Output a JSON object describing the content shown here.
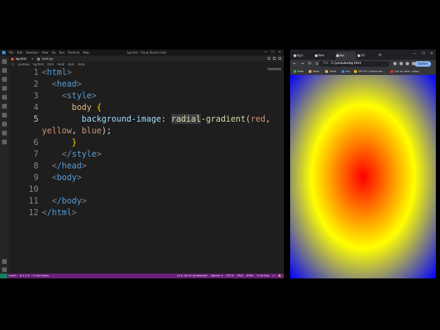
{
  "vscode": {
    "menu": [
      "File",
      "Edit",
      "Selection",
      "View",
      "Go",
      "Run",
      "Terminal",
      "Help"
    ],
    "window_title": "bg.html - Visual Studio Code",
    "window_controls": [
      "—",
      "☐",
      "✕"
    ],
    "tabs": [
      {
        "label": "bg.html",
        "active": true
      },
      {
        "label": "Settings",
        "active": false
      }
    ],
    "breadcrumb": [
      "C:",
      "youtube",
      "bg.html",
      "html",
      "head",
      "style",
      "body"
    ],
    "code_lines": [
      {
        "num": "1"
      },
      {
        "num": "2"
      },
      {
        "num": "3"
      },
      {
        "num": "4"
      },
      {
        "num": "5"
      },
      {
        "num": "6"
      },
      {
        "num": "7"
      },
      {
        "num": "8"
      },
      {
        "num": "9"
      },
      {
        "num": "10"
      },
      {
        "num": "11"
      },
      {
        "num": "12"
      }
    ],
    "code": {
      "html_tag": "html",
      "head_tag": "head",
      "style_tag": "style",
      "selector": "body",
      "open_brace": "{",
      "property": "background-image",
      "colon": ":",
      "fn_highlight": "radial",
      "fn_rest": "-gradient",
      "open_paren": "(",
      "val_red": "red",
      "comma1": ",",
      "val_yellow": "yellow",
      "comma2": ",",
      "val_blue": "blue",
      "close_paren_semicolon": ");",
      "close_brace": "}",
      "close_style": "/style",
      "close_head": "/head",
      "body_tag": "body",
      "close_body": "/body",
      "close_html": "/html"
    },
    "status_left": [
      "main*",
      "⊗ 0 ⚠ 0",
      "⊙ Live Share"
    ],
    "status_right": [
      "Ln 5, Col 31 (6 selected)",
      "Spaces: 4",
      "UTF-8",
      "CRLF",
      "HTML",
      "⊙ Go Live",
      "⚇",
      "🔔"
    ],
    "colors": {
      "status_bar": "#68217a",
      "editor_bg": "#1e1e1e"
    }
  },
  "chrome": {
    "tabs": [
      {
        "label": "bg.h",
        "active": false
      },
      {
        "label": "New",
        "active": false
      },
      {
        "label": "bac",
        "active": true
      },
      {
        "label": "20.",
        "active": false
      }
    ],
    "new_tab": "+",
    "window_controls": [
      "—",
      "☐",
      "✕"
    ],
    "nav": [
      "←",
      "→",
      "↻",
      "⌂"
    ],
    "omnibox": {
      "scheme_label": "File",
      "url": "C:/youtube/bg.html"
    },
    "update_button": "Update",
    "bookmarks": [
      "Root",
      "Work",
      "Trello",
      "Pay",
      "DJI FPV Combo wit...",
      "List an item | eBay"
    ],
    "page": {
      "css": "radial-gradient(red, yellow, blue)",
      "gradient_colors": [
        "red",
        "yellow",
        "blue"
      ]
    }
  }
}
